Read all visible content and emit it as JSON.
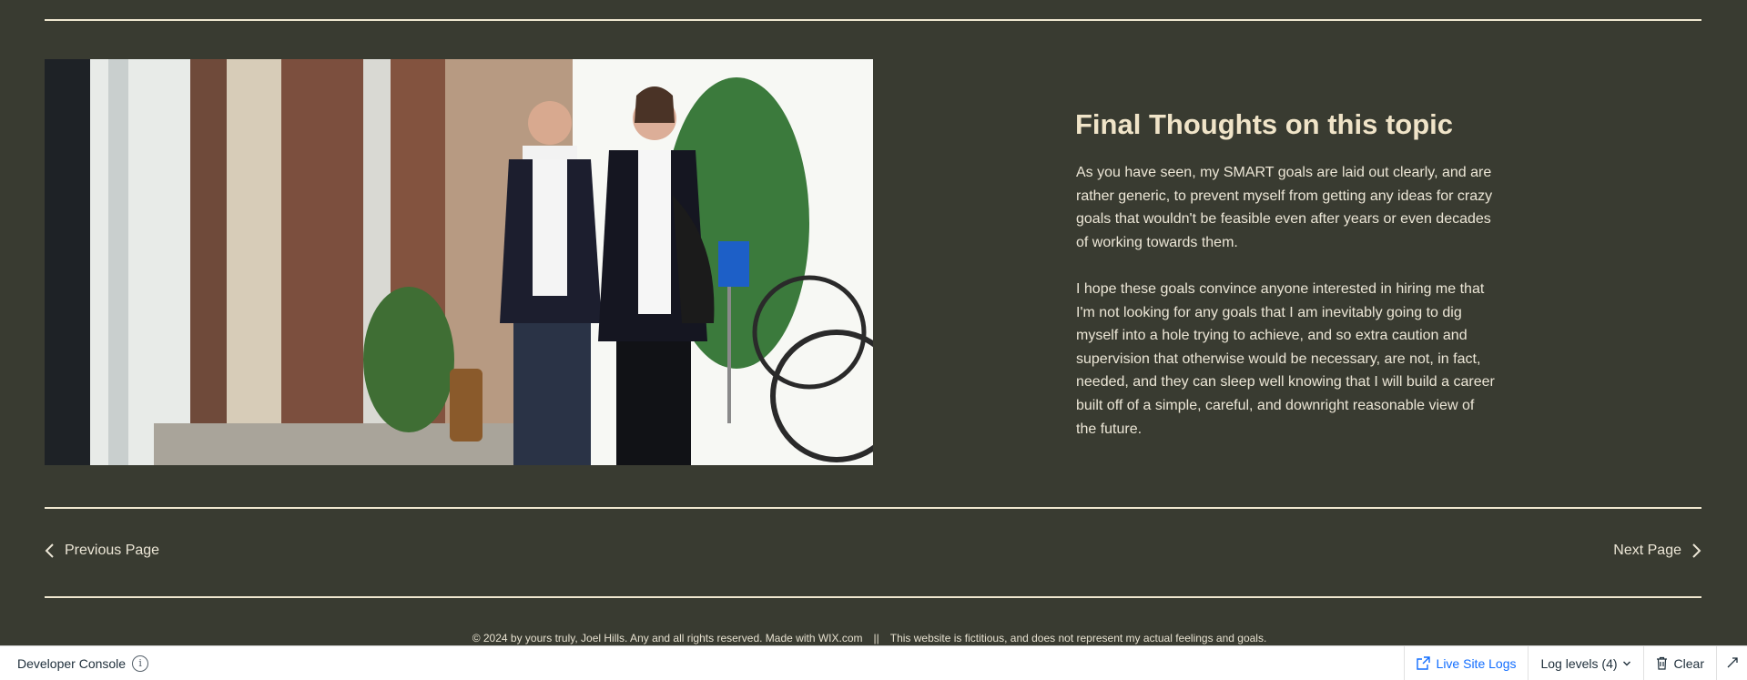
{
  "article": {
    "heading": "Final Thoughts on this topic",
    "paragraph_1": "As you have seen, my SMART goals are laid out clearly, and are rather generic, to prevent myself from getting any ideas for crazy goals that wouldn't be feasible even after years or even decades of working towards them.",
    "paragraph_2": "I hope these goals convince anyone interested in hiring me that I'm not looking for any goals that I am inevitably going to dig myself into a hole trying to achieve, and so extra caution and supervision that otherwise would be necessary, are not, in fact, needed, and they can sleep well knowing that I will build a career built off of a simple, careful, and downright reasonable view of the future."
  },
  "nav": {
    "previous_label": "Previous Page",
    "next_label": "Next Page"
  },
  "footer": {
    "copyright": "© 2024 by yours truly, Joel Hills. Any and all rights reserved. Made with WIX.com",
    "separator": "||",
    "disclaimer": "This website is fictitious, and does not represent my actual feelings and goals."
  },
  "dev_console": {
    "title": "Developer Console",
    "live_logs_label": "Live Site Logs",
    "log_levels_label": "Log levels (4)",
    "clear_label": "Clear"
  },
  "colors": {
    "background": "#393b31",
    "heading": "#f0e4c8",
    "rule": "#efe7cf",
    "link_blue": "#116dff"
  },
  "icons": [
    "chevron-left-icon",
    "chevron-right-icon",
    "info-icon",
    "external-link-icon",
    "chevron-down-icon",
    "trash-icon",
    "expand-icon"
  ]
}
